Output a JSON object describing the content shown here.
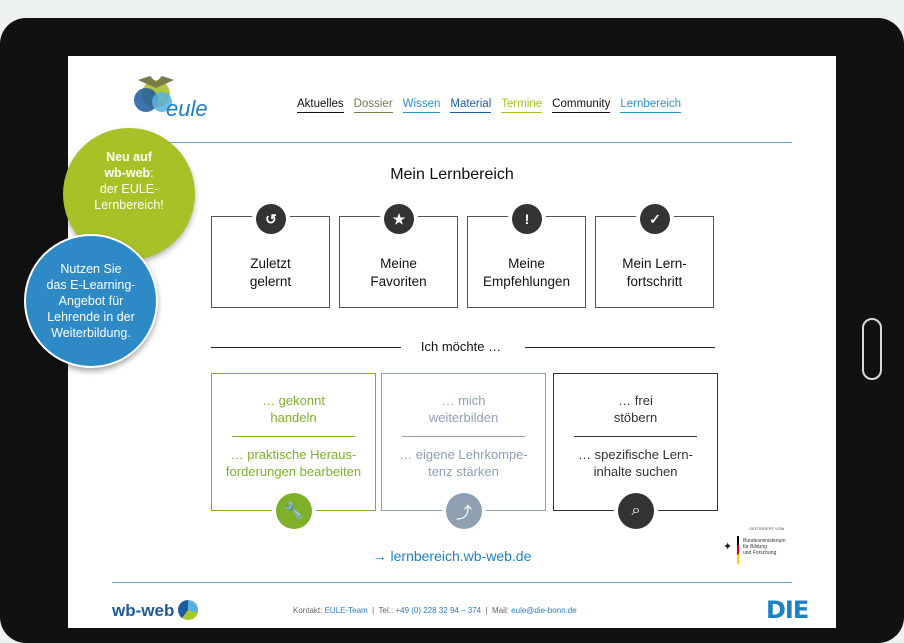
{
  "brand": {
    "name": "eule"
  },
  "nav": [
    {
      "label": "Aktuelles",
      "color": "#111111"
    },
    {
      "label": "Dossier",
      "color": "#7a7a4a"
    },
    {
      "label": "Wissen",
      "color": "#2b92c8"
    },
    {
      "label": "Material",
      "color": "#1e5aa0"
    },
    {
      "label": "Termine",
      "color": "#a8c127"
    },
    {
      "label": "Community",
      "color": "#111111"
    },
    {
      "label": "Lernbereich",
      "color": "#2b92c8"
    }
  ],
  "title": "Mein Lernbereich",
  "cards": [
    {
      "line1": "Zuletzt",
      "line2": "gelernt",
      "icon": "history-icon"
    },
    {
      "line1": "Meine",
      "line2": "Favoriten",
      "icon": "star-icon"
    },
    {
      "line1": "Meine",
      "line2": "Empfehlungen",
      "icon": "recommendation-icon"
    },
    {
      "line1": "Mein Lern-",
      "line2": "fortschritt",
      "icon": "check-icon"
    }
  ],
  "section_label": "Ich möchte …",
  "boxes": [
    {
      "a1": "… gekonnt",
      "a2": "handeln",
      "b1": "… praktische Heraus-",
      "b2": "forderungen bearbeiten",
      "color": "#7fb02a",
      "icon": "wrench-icon"
    },
    {
      "a1": "… mich",
      "a2": "weiterbilden",
      "b1": "… eigene Lehrkompe-",
      "b2": "tenz stärken",
      "color": "#8fa0b3",
      "icon": "stairs-icon"
    },
    {
      "a1": "… frei",
      "a2": "stöbern",
      "b1": "… spezifische Lern-",
      "b2": "inhalte suchen",
      "color": "#333333",
      "icon": "search-icon"
    }
  ],
  "link": "→ lernbereich.wb-web.de",
  "funder": {
    "caption": "GEFÖRDERT VOM",
    "line1": "Bundesministerium",
    "line2": "für Bildung",
    "line3": "und Forschung"
  },
  "footer": {
    "logo": "wb-web",
    "contact_label": "Kontakt:",
    "contact_value": "EULE-Team",
    "tel_label": "Tel.:",
    "tel_value": "+49 (0) 228 32 94 – 374",
    "mail_label": "Mail:",
    "mail_value": "eule@die-bonn.de",
    "partner_logo": "DIE"
  },
  "bubble1": {
    "l1": "Neu auf",
    "l2": "wb-web",
    "l2b": ":",
    "l3": "der EULE-",
    "l4": "Lernbereich!"
  },
  "bubble2": {
    "l1": "Nutzen Sie",
    "l2": "das E-Learning-",
    "l3": "Angebot für",
    "l4": "Lehrende in der",
    "l5": "Weiterbildung."
  }
}
